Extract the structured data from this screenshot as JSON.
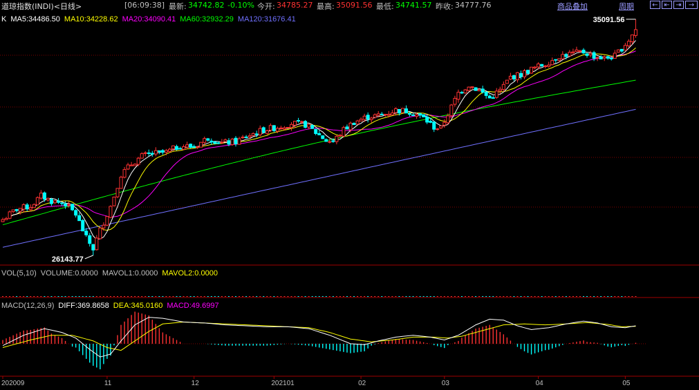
{
  "header": {
    "title": "道琼指数(INDI)<日线>",
    "time": "[06:09:38]",
    "latest_label": "最新:",
    "latest": "34742.82",
    "change": "-0.10%",
    "open_label": "今开:",
    "open": "34785.27",
    "high_label": "最高:",
    "high": "35091.56",
    "low_label": "最低:",
    "low": "34741.57",
    "prev_label": "昨收:",
    "prev": "34777.76",
    "overlay_link": "商品叠加",
    "period_link": "周期",
    "buttons": [
      "←",
      "⇤",
      "⇥",
      "→",
      "+",
      "−"
    ]
  },
  "colors": {
    "up": "#ff3232",
    "down": "#00ffff",
    "ma5": "#ffffff",
    "ma10": "#ffff00",
    "ma20": "#ff00ff",
    "ma60": "#00ff00",
    "ma120": "#7070ff",
    "grid": "#800000",
    "axis": "#a00000"
  },
  "chart_data": [
    {
      "type": "candlestick",
      "legend": [
        {
          "label": "K",
          "color": "#ffffff"
        },
        {
          "label": "MA5:34486.50",
          "color": "#ffffff"
        },
        {
          "label": "MA10:34228.62",
          "color": "#ffff00"
        },
        {
          "label": "MA20:34090.41",
          "color": "#ff00ff"
        },
        {
          "label": "MA60:32932.29",
          "color": "#00ff00"
        },
        {
          "label": "MA120:31676.41",
          "color": "#7070ff"
        }
      ],
      "ylim": [
        25800,
        35350
      ],
      "high_label": "35091.56",
      "low_label": "26143.77",
      "anchors": [
        [
          0,
          27500
        ],
        [
          4,
          27900
        ],
        [
          8,
          28000
        ],
        [
          11,
          28400
        ],
        [
          14,
          28200
        ],
        [
          18,
          28100
        ],
        [
          21,
          27700
        ],
        [
          24,
          26800
        ],
        [
          26,
          26400
        ],
        [
          28,
          27100
        ],
        [
          31,
          28000
        ],
        [
          34,
          29200
        ],
        [
          37,
          29600
        ],
        [
          40,
          29900
        ],
        [
          43,
          30000
        ],
        [
          47,
          30050
        ],
        [
          51,
          30300
        ],
        [
          55,
          30250
        ],
        [
          59,
          30600
        ],
        [
          63,
          30400
        ],
        [
          67,
          30450
        ],
        [
          71,
          30700
        ],
        [
          75,
          30900
        ],
        [
          79,
          31000
        ],
        [
          83,
          31150
        ],
        [
          87,
          31100
        ],
        [
          90,
          30800
        ],
        [
          93,
          30500
        ],
        [
          95,
          30450
        ],
        [
          98,
          30900
        ],
        [
          101,
          31200
        ],
        [
          105,
          31400
        ],
        [
          109,
          31450
        ],
        [
          113,
          31650
        ],
        [
          117,
          31600
        ],
        [
          121,
          31350
        ],
        [
          124,
          31000
        ],
        [
          126,
          30950
        ],
        [
          128,
          31500
        ],
        [
          131,
          32300
        ],
        [
          134,
          32600
        ],
        [
          137,
          32400
        ],
        [
          140,
          32100
        ],
        [
          143,
          32400
        ],
        [
          146,
          32900
        ],
        [
          149,
          33000
        ],
        [
          152,
          33200
        ],
        [
          156,
          33400
        ],
        [
          160,
          33700
        ],
        [
          164,
          33800
        ],
        [
          167,
          33850
        ],
        [
          170,
          33700
        ],
        [
          173,
          33600
        ],
        [
          176,
          33700
        ],
        [
          178,
          34000
        ],
        [
          180,
          34300
        ],
        [
          182,
          34700
        ]
      ],
      "ma_end": {
        "ma5": 34486.5,
        "ma10": 34228.62,
        "ma20": 34090.41,
        "ma60": 32932.29,
        "ma120": 31676.41
      }
    },
    {
      "type": "bar",
      "legend": [
        {
          "label": "VOL(5,10)",
          "color": "#c0c0c0"
        },
        {
          "label": "VOLUME:0.0000",
          "color": "#c0c0c0"
        },
        {
          "label": "MAVOL1:0.0000",
          "color": "#c0c0c0"
        },
        {
          "label": "MAVOL2:0.0000",
          "color": "#ffff00"
        }
      ]
    },
    {
      "type": "bar",
      "legend": [
        {
          "label": "MACD(12,26,9)",
          "color": "#c0c0c0"
        },
        {
          "label": "DIFF:369.8658",
          "color": "#ffffff"
        },
        {
          "label": "DEA:345.0160",
          "color": "#ffff00"
        },
        {
          "label": "MACD:49.6997",
          "color": "#ff00ff"
        }
      ],
      "ylim": [
        -320,
        360
      ],
      "diff_anchors": [
        [
          0,
          -20
        ],
        [
          6,
          90
        ],
        [
          12,
          160
        ],
        [
          17,
          120
        ],
        [
          21,
          60
        ],
        [
          25,
          -60
        ],
        [
          28,
          -140
        ],
        [
          31,
          -110
        ],
        [
          34,
          30
        ],
        [
          38,
          200
        ],
        [
          42,
          280
        ],
        [
          46,
          270
        ],
        [
          52,
          230
        ],
        [
          58,
          220
        ],
        [
          64,
          200
        ],
        [
          70,
          190
        ],
        [
          76,
          180
        ],
        [
          82,
          180
        ],
        [
          88,
          160
        ],
        [
          94,
          90
        ],
        [
          100,
          0
        ],
        [
          104,
          -10
        ],
        [
          108,
          30
        ],
        [
          113,
          70
        ],
        [
          118,
          90
        ],
        [
          123,
          70
        ],
        [
          127,
          40
        ],
        [
          131,
          90
        ],
        [
          136,
          200
        ],
        [
          140,
          260
        ],
        [
          144,
          250
        ],
        [
          148,
          190
        ],
        [
          152,
          150
        ],
        [
          157,
          170
        ],
        [
          162,
          210
        ],
        [
          167,
          240
        ],
        [
          171,
          220
        ],
        [
          175,
          180
        ],
        [
          179,
          170
        ],
        [
          182,
          190
        ]
      ],
      "dea_anchors": [
        [
          0,
          -40
        ],
        [
          8,
          40
        ],
        [
          14,
          90
        ],
        [
          20,
          90
        ],
        [
          26,
          30
        ],
        [
          30,
          -40
        ],
        [
          34,
          -70
        ],
        [
          38,
          30
        ],
        [
          42,
          130
        ],
        [
          46,
          210
        ],
        [
          52,
          230
        ],
        [
          58,
          220
        ],
        [
          64,
          210
        ],
        [
          70,
          200
        ],
        [
          76,
          190
        ],
        [
          82,
          180
        ],
        [
          88,
          170
        ],
        [
          94,
          120
        ],
        [
          100,
          50
        ],
        [
          106,
          20
        ],
        [
          112,
          40
        ],
        [
          118,
          70
        ],
        [
          124,
          70
        ],
        [
          128,
          60
        ],
        [
          132,
          80
        ],
        [
          138,
          140
        ],
        [
          144,
          200
        ],
        [
          150,
          210
        ],
        [
          156,
          200
        ],
        [
          162,
          210
        ],
        [
          168,
          225
        ],
        [
          174,
          205
        ],
        [
          178,
          180
        ],
        [
          182,
          185
        ]
      ]
    }
  ],
  "x_axis": {
    "labels": [
      {
        "text": "202009",
        "i": 0
      },
      {
        "text": "11",
        "i": 30
      },
      {
        "text": "12",
        "i": 55
      },
      {
        "text": "202101",
        "i": 78
      },
      {
        "text": "02",
        "i": 103
      },
      {
        "text": "03",
        "i": 127
      },
      {
        "text": "04",
        "i": 154
      },
      {
        "text": "05",
        "i": 179
      }
    ]
  }
}
